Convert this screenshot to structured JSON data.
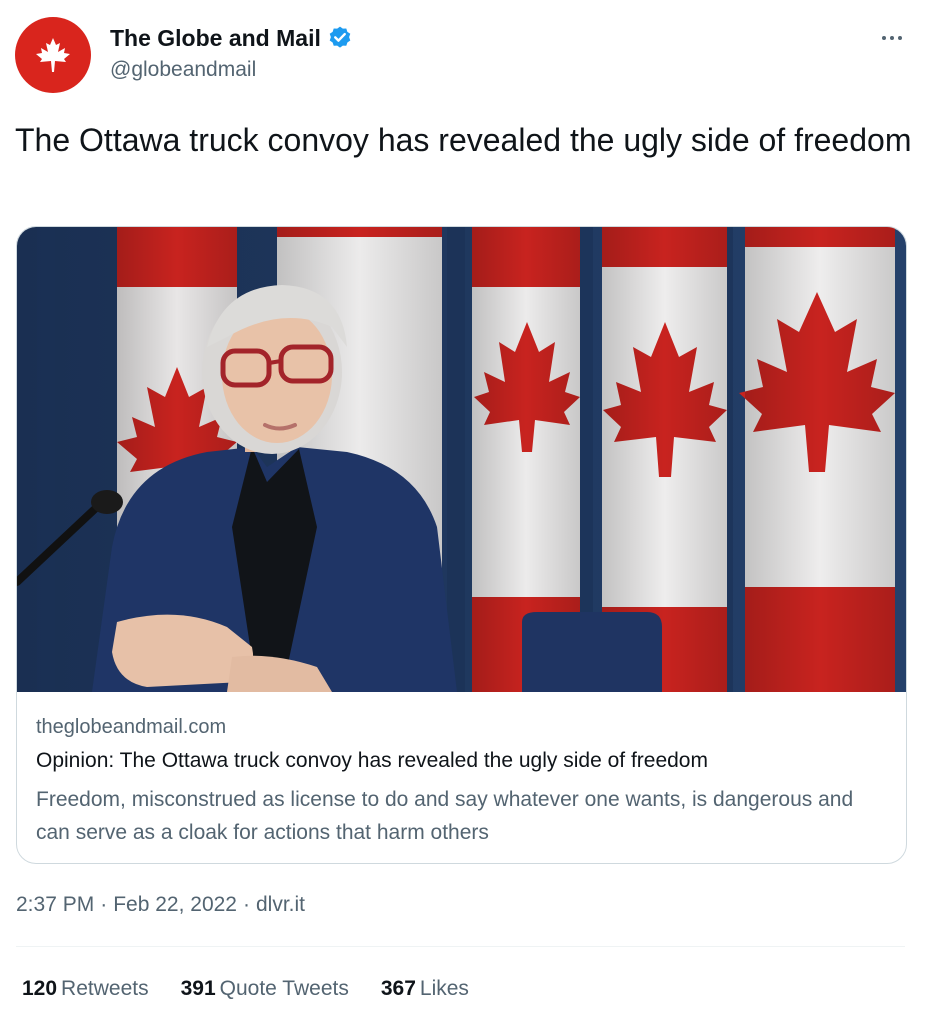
{
  "author": {
    "display_name": "The Globe and Mail",
    "handle": "@globeandmail",
    "avatar_icon": "maple-leaf-icon",
    "verified_icon": "verified-badge-icon",
    "brand_color": "#d9251d",
    "verified_color": "#1d9bf0"
  },
  "more_icon": "ellipsis-icon",
  "tweet": {
    "text": "The Ottawa truck convoy has revealed the ugly side of freedom"
  },
  "card": {
    "image_alt": "photo",
    "domain": "theglobeandmail.com",
    "title": "Opinion: The Ottawa truck convoy has revealed the ugly side of freedom",
    "description": "Freedom, misconstrued as license to do and say whatever one wants, is dangerous and can serve as a cloak for actions that harm others"
  },
  "meta": {
    "time": "2:37 PM",
    "sep1": "·",
    "date": "Feb 22, 2022",
    "sep2": "·",
    "source": "dlvr.it"
  },
  "stats": {
    "retweets": {
      "count": "120",
      "label": "Retweets"
    },
    "quotes": {
      "count": "391",
      "label": "Quote Tweets"
    },
    "likes": {
      "count": "367",
      "label": "Likes"
    }
  }
}
